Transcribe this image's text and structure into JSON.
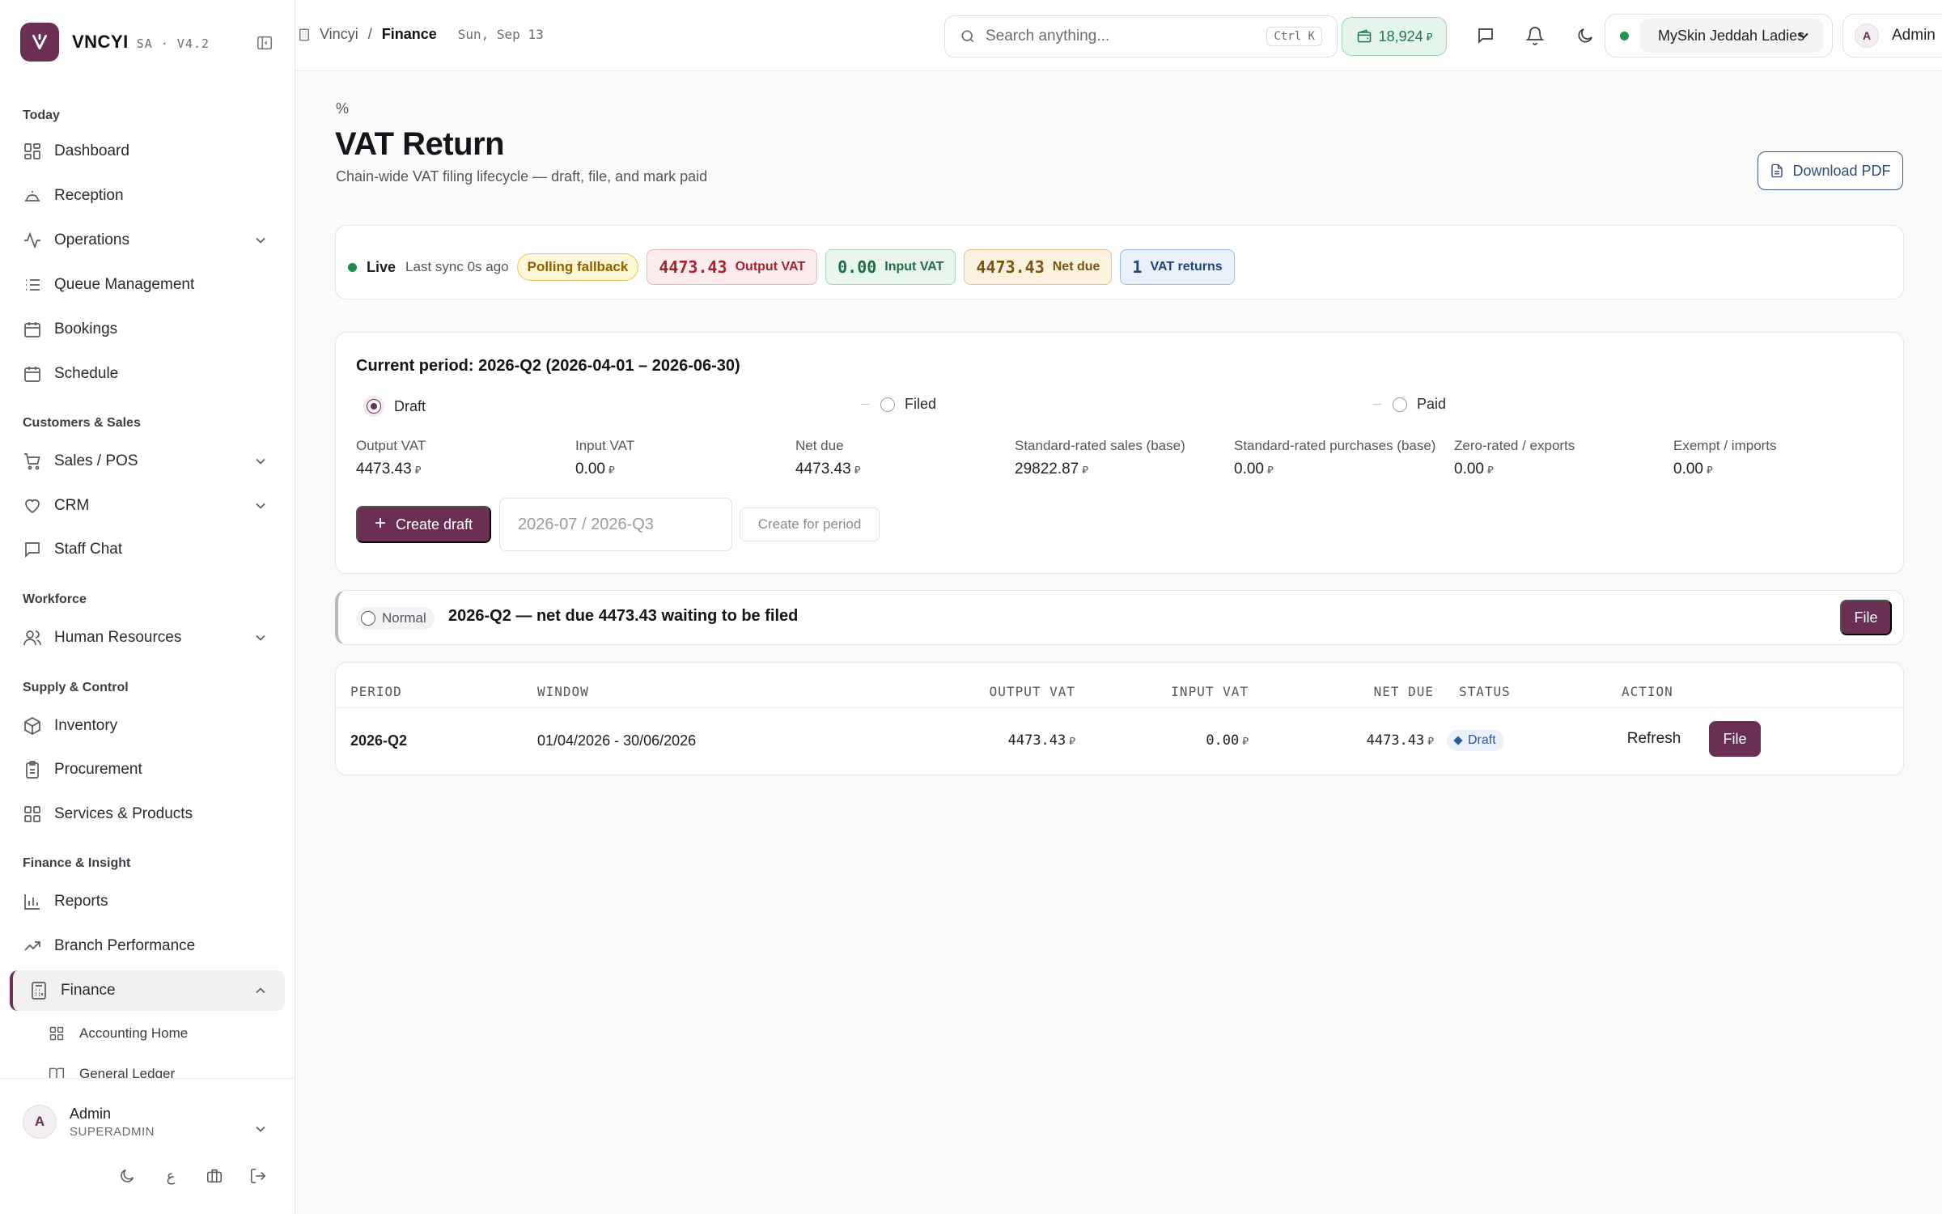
{
  "brand": {
    "name": "VNCYI",
    "version": "SA · V4.2",
    "color": "#6b2f54"
  },
  "sidebar": {
    "sections": {
      "today": "Today",
      "customers": "Customers & Sales",
      "workforce": "Workforce",
      "supply": "Supply & Control",
      "finance": "Finance & Insight"
    },
    "items": {
      "dashboard": "Dashboard",
      "reception": "Reception",
      "operations": "Operations",
      "queue": "Queue Management",
      "bookings": "Bookings",
      "schedule": "Schedule",
      "sales": "Sales / POS",
      "crm": "CRM",
      "staffchat": "Staff Chat",
      "hr": "Human Resources",
      "inventory": "Inventory",
      "procurement": "Procurement",
      "services": "Services & Products",
      "reports": "Reports",
      "branchperf": "Branch Performance",
      "finance": "Finance",
      "accounting": "Accounting Home",
      "ledger": "General Ledger"
    },
    "footer": {
      "initial": "A",
      "name": "Admin",
      "role": "SUPERADMIN"
    }
  },
  "topbar": {
    "crumb_root": "Vincyi",
    "crumb_sep": "/",
    "crumb_current": "Finance",
    "date": "Sun, Sep 13",
    "search_placeholder": "Search anything...",
    "search_kbd": "Ctrl K",
    "coins": "18,924",
    "branch": "MySkin Jeddah Ladies",
    "user_initial": "A",
    "user_name": "Admin"
  },
  "page": {
    "icon": "%",
    "title": "VAT Return",
    "subtitle": "Chain-wide VAT filing lifecycle — draft, file, and mark paid",
    "download_label": "Download PDF"
  },
  "live": {
    "status": "Live",
    "sync": "Last sync 0s ago",
    "mode": "Polling fallback",
    "stats": [
      {
        "value": "4473.43",
        "label": "Output VAT"
      },
      {
        "value": "0.00",
        "label": "Input VAT"
      },
      {
        "value": "4473.43",
        "label": "Net due"
      },
      {
        "value": "1",
        "label": "VAT returns"
      }
    ]
  },
  "period": {
    "title": "Current period: 2026-Q2 (2026-04-01 – 2026-06-30)",
    "steps": [
      "Draft",
      "Filed",
      "Paid"
    ],
    "currency": "⃁",
    "metrics": [
      {
        "label": "Output VAT",
        "value": "4473.43"
      },
      {
        "label": "Input VAT",
        "value": "0.00"
      },
      {
        "label": "Net due",
        "value": "4473.43"
      },
      {
        "label": "Standard-rated sales (base)",
        "value": "29822.87"
      },
      {
        "label": "Standard-rated purchases (base)",
        "value": "0.00"
      },
      {
        "label": "Zero-rated / exports",
        "value": "0.00"
      },
      {
        "label": "Exempt / imports",
        "value": "0.00"
      }
    ],
    "create_label": "Create draft",
    "input_placeholder": "2026-07 / 2026-Q3",
    "create_for_label": "Create for period"
  },
  "alert": {
    "badge": "Normal",
    "text": "2026-Q2 — net due 4473.43 waiting to be filed",
    "action": "File"
  },
  "table": {
    "headers": [
      "PERIOD",
      "WINDOW",
      "OUTPUT VAT",
      "INPUT VAT",
      "NET DUE",
      "STATUS",
      "ACTION"
    ],
    "rows": [
      {
        "period": "2026-Q2",
        "window": "01/04/2026 - 30/06/2026",
        "output": "4473.43",
        "input": "0.00",
        "net": "4473.43",
        "status": "Draft",
        "refresh": "Refresh",
        "file": "File"
      }
    ]
  }
}
